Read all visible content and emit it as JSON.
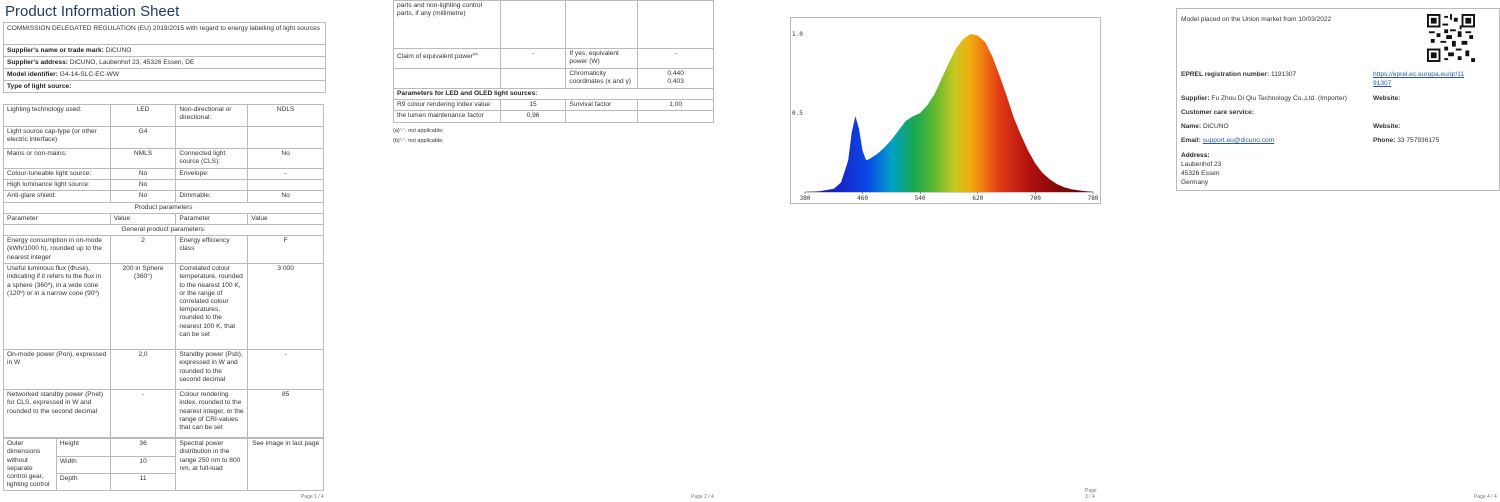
{
  "page1": {
    "title": "Product Information Sheet",
    "regulation": "COMMISSION DELEGATED REGULATION (EU) 2019/2015 with regard to energy labelling of light sources",
    "supplier_name_label": "Supplier's name or trade mark:",
    "supplier_name": "DiCUNO",
    "supplier_address_label": "Supplier's address:",
    "supplier_address": "DiCUNO, Laubenhof 23, 45326 Essen, DE",
    "model_label": "Model identifier:",
    "model": "G4-14-SLC-EC-WW",
    "type_label": "Type of light source:",
    "lighting_tech_label": "Lighting technology used:",
    "lighting_tech": "LED",
    "non_directional_label": "Non-directional or directional:",
    "non_directional": "NDLS",
    "cap_type_label": "Light source cap-type (or other electric interface)",
    "cap_type": "G4",
    "mains_label": "Mains or non-mains:",
    "mains": "NMLS",
    "connected_label": "Connected light source (CLS):",
    "connected": "No",
    "colour_tuneable_label": "Colour-tuneable light source:",
    "colour_tuneable": "No",
    "envelope_label": "Envelope:",
    "envelope": "-",
    "high_lum_label": "High luminance light source:",
    "high_lum": "No",
    "anti_glare_label": "Anti-glare shield:",
    "anti_glare": "No",
    "dimmable_label": "Dimmable:",
    "dimmable": "No",
    "product_params": "Product parameters",
    "col_parameter": "Parameter",
    "col_value": "Value",
    "general_params": "General product parameters:",
    "energy_consumption_label": "Energy consumption in on-mode (kWh/1000 h), rounded up to the nearest integer",
    "energy_consumption": "2",
    "efficiency_class_label": "Energy efficiency class",
    "efficiency_class": "F",
    "flux_label": "Useful luminous flux (Φuse), indicating if it refers to the flux in a sphere (360º), in a wide cone (120º) or in a narrow cone (90º)",
    "flux": "200 in Sphere (360°)",
    "cct_label": "Correlated colour temperature, rounded to the nearest 100 K, or the range of correlated colour temperatures, rounded to the nearest 100 K, that can be set",
    "cct": "3 000",
    "on_power_label": "On-mode power (Pon), expressed in W",
    "on_power": "2,0",
    "standby_label": "Standby power (Psb), expressed in W and rounded to the second decimal",
    "standby": "-",
    "net_standby_label": "Networked standby power (Pnet) for CLS, expressed in W and rounded to the second decimal",
    "net_standby": "-",
    "cri_label": "Colour rendering index, rounded to the nearest integer, or the range of CRI-values that can be set",
    "cri": "85",
    "outer_dim_label": "Outer dimensions without separate control gear, lighting control",
    "height_label": "Height",
    "height": "36",
    "width_label": "Width",
    "width": "10",
    "depth_label": "Depth",
    "depth": "11",
    "spd_label": "Spectral power distribution in the range 250 nm to 800 nm, at full-load",
    "spd": "See image in last page",
    "page_num": "Page 1 / 4"
  },
  "page2": {
    "cont_label": "parts and non-lighting control parts, if any (millimetre)",
    "equiv_power_label": "Claim of equivalent power",
    "equiv_power_note": "(a)",
    "equiv_power": "-",
    "if_yes_label": "If yes, equivalent power (W)",
    "if_yes": "-",
    "chromaticity_label": "Chromaticity coordinates (x and y)",
    "chromaticity_x": "0,440",
    "chromaticity_y": "0,403",
    "led_params": "Parameters for LED and OLED light sources:",
    "r9_label": "R9 colour rendering index value",
    "r9": "15",
    "survival_label": "Survival factor",
    "survival": "1,00",
    "lumen_maint_label": "the lumen maintenance factor",
    "lumen_maint": "0,96",
    "note_a": "(a)'-' : not applicable;",
    "note_b": "(b)'-' : not applicable;",
    "page_num": "Page 2 / 4"
  },
  "page3": {
    "page_num": "Page 3 / 4"
  },
  "chart_data": {
    "type": "area",
    "title": "",
    "xlabel": "",
    "ylabel": "",
    "x_ticks": [
      "380",
      "460",
      "540",
      "620",
      "700",
      "780"
    ],
    "y_ticks": [
      "0.5",
      "1.0"
    ],
    "xlim": [
      380,
      780
    ],
    "ylim": [
      0,
      1.0
    ],
    "grid": false,
    "series": [
      {
        "x": [
          380,
          400,
          420,
          430,
          440,
          445,
          450,
          455,
          460,
          465,
          470,
          480,
          490,
          500,
          510,
          520,
          530,
          540,
          550,
          560,
          570,
          580,
          590,
          600,
          610,
          620,
          630,
          640,
          650,
          660,
          670,
          680,
          690,
          700,
          710,
          720,
          730,
          740,
          750,
          760,
          770,
          780
        ],
        "values": [
          0,
          0.005,
          0.02,
          0.06,
          0.2,
          0.38,
          0.48,
          0.4,
          0.26,
          0.2,
          0.21,
          0.24,
          0.28,
          0.33,
          0.39,
          0.45,
          0.48,
          0.5,
          0.55,
          0.62,
          0.72,
          0.82,
          0.91,
          0.97,
          1.0,
          0.99,
          0.95,
          0.86,
          0.74,
          0.61,
          0.47,
          0.36,
          0.26,
          0.18,
          0.12,
          0.08,
          0.05,
          0.03,
          0.018,
          0.01,
          0.005,
          0.002
        ]
      }
    ]
  },
  "page4": {
    "market_text": "Model placed on the Union market from 10/03/2022",
    "eprel_label": "EPREL registration number:",
    "eprel": "1191307",
    "eprel_url_1": "https://eprel.ec.europa.eu/qr/11",
    "eprel_url_2": "91307",
    "supplier_label": "Supplier:",
    "supplier": "Fu Zhou Di Qiu Technology Co.,Ltd. (Importer)",
    "website_label": "Website:",
    "care_label": "Customer care service:",
    "name_label": "Name:",
    "name": "DiCUNO",
    "website2_label": "Website:",
    "email_label": "Email:",
    "email": "support.eu@dicuno.com",
    "phone_label": "Phone:",
    "phone": "33 757936175",
    "address_label": "Address:",
    "address_1": "Laubenhof 23",
    "address_2": "45326 Essen",
    "address_3": "Germany",
    "page_num": "Page 4 / 4"
  }
}
